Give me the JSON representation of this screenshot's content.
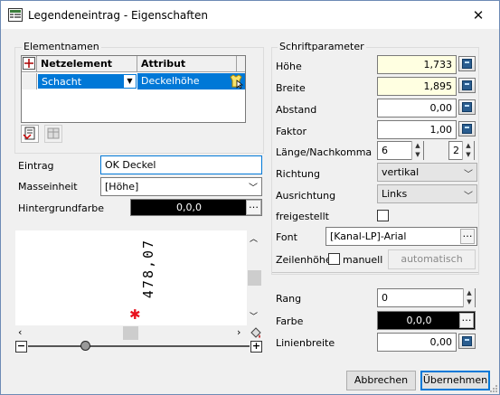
{
  "window": {
    "title": "Legendeneintrag - Eigenschaften",
    "close_glyph": "✕"
  },
  "elements": {
    "group_title": "Elementnamen",
    "columns": [
      "Netzelement",
      "Attribut"
    ],
    "row": {
      "netzelement": "Schacht",
      "attribut": "Deckelhöhe"
    }
  },
  "eintrag": {
    "label": "Eintrag",
    "value": "OK Deckel"
  },
  "masseinheit": {
    "label": "Masseinheit",
    "value": "[Höhe]"
  },
  "hintergrundfarbe": {
    "label": "Hintergrundfarbe",
    "value": "0,0,0"
  },
  "preview": {
    "text": "478,07"
  },
  "schrift": {
    "group_title": "Schriftparameter",
    "hoehe": {
      "label": "Höhe",
      "value": "1,733"
    },
    "breite": {
      "label": "Breite",
      "value": "1,895"
    },
    "abstand": {
      "label": "Abstand",
      "value": "0,00"
    },
    "faktor": {
      "label": "Faktor",
      "value": "1,00"
    },
    "laenge": {
      "label": "Länge/Nachkomma",
      "value1": "6",
      "value2": "2"
    },
    "richtung": {
      "label": "Richtung",
      "value": "vertikal"
    },
    "ausrichtung": {
      "label": "Ausrichtung",
      "value": "Links"
    },
    "freigestellt": {
      "label": "freigestellt"
    },
    "font": {
      "label": "Font",
      "value": "[Kanal-LP]-Arial"
    },
    "zeilenhoehe": {
      "label": "Zeilenhöhe",
      "manuell": "manuell",
      "button": "automatisch"
    }
  },
  "rang": {
    "label": "Rang",
    "value": "0"
  },
  "farbe": {
    "label": "Farbe",
    "value": "0,0,0"
  },
  "linienbreite": {
    "label": "Linienbreite",
    "value": "0,00"
  },
  "buttons": {
    "cancel": "Abbrechen",
    "ok": "Übernehmen"
  },
  "colors": {
    "accent": "#0078d7",
    "highlight_field": "#ffffe1",
    "marker": "#e8121f"
  }
}
